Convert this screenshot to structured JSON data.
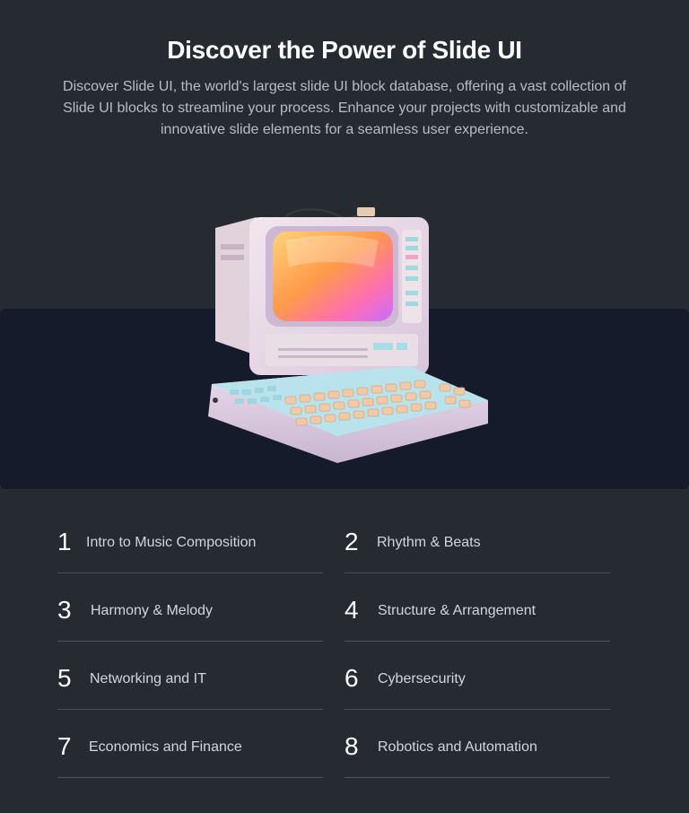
{
  "header": {
    "title": "Discover the Power of Slide UI",
    "description": "Discover Slide UI, the world's largest slide UI block database, offering a vast collection of Slide UI blocks to streamline your process. Enhance your projects with customizable and innovative slide elements for a seamless user experience."
  },
  "hero": {
    "image": "retro-computer-illustration"
  },
  "topics": [
    {
      "number": "1",
      "label": "Intro to Music Composition"
    },
    {
      "number": "2",
      "label": "Rhythm & Beats"
    },
    {
      "number": "3",
      "label": "Harmony & Melody"
    },
    {
      "number": "4",
      "label": "Structure & Arrangement"
    },
    {
      "number": "5",
      "label": "Networking and IT"
    },
    {
      "number": "6",
      "label": "Cybersecurity"
    },
    {
      "number": "7",
      "label": "Economics and Finance"
    },
    {
      "number": "8",
      "label": "Robotics and Automation"
    }
  ],
  "colors": {
    "background": "#262b32",
    "band": "#151b2a",
    "divider": "#4a4f57"
  }
}
